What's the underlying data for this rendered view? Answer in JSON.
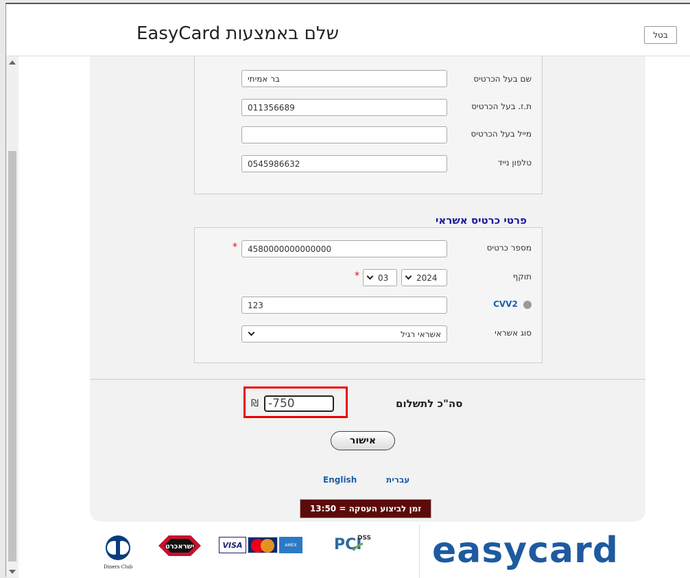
{
  "header": {
    "title": "שלם באמצעות EasyCard",
    "cancel_label": "בטל"
  },
  "cardholder": {
    "name_label": "שם בעל הכרטיס",
    "name_value": "בר אמיתי",
    "id_label": "ת.ז. בעל הכרטיס",
    "id_value": "011356689",
    "email_label": "מייל בעל הכרטיס",
    "email_value": "",
    "phone_label": "טלפון נייד",
    "phone_value": "0545986632"
  },
  "card": {
    "section_title": "פרטי כרטיס אשראי",
    "number_label": "מספר כרטיס",
    "number_value": "4580000000000000",
    "expiry_label": "תוקף",
    "expiry_month": "03",
    "expiry_year": "2024",
    "cvv_label": "CVV2",
    "cvv_value": "123",
    "type_label": "סוג אשראי",
    "type_value": "אשראי רגיל",
    "required_mark": "*"
  },
  "payment": {
    "total_label": "סה\"כ לתשלום",
    "total_value": "-750",
    "currency_symbol": "₪",
    "confirm_label": "אישור",
    "lang_english": "English",
    "lang_hebrew": "עברית",
    "timer_text": "זמן לביצוע העסקה = 13:50"
  },
  "footer": {
    "brand_text": "easycard",
    "visa_text": "VISA",
    "pci_text": "PCI DSS",
    "diners_text": "Diners Club"
  },
  "colors": {
    "accent_blue": "#1e5aa0",
    "section_title": "#1a1aa0",
    "highlight_red": "#e00000",
    "timer_bg": "#5c0b0b"
  }
}
